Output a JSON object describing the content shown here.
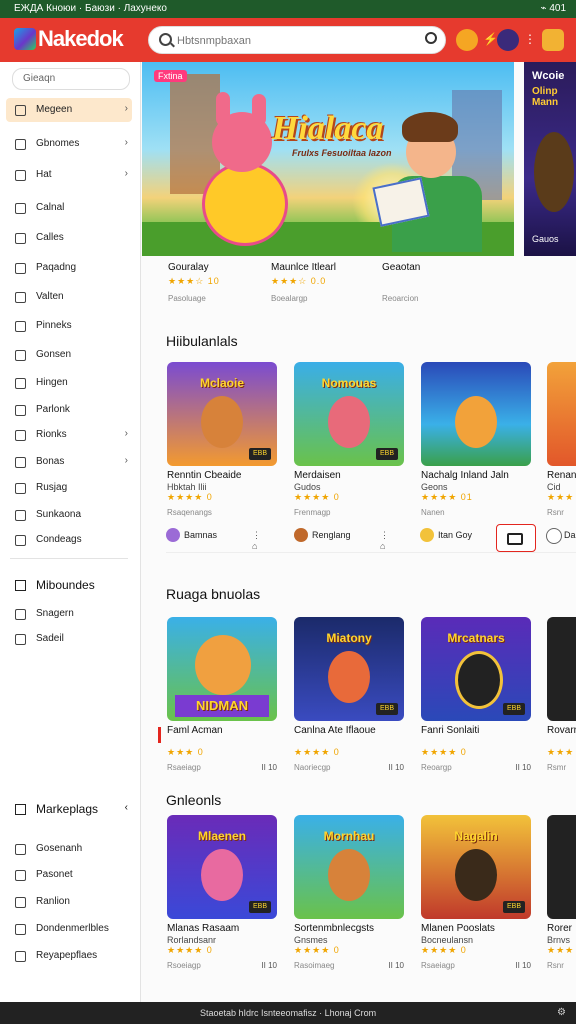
{
  "status": {
    "left": "ЕЖДА  Кноюи · Баюзи  ·  Лахунеко",
    "right": "⌁ 401"
  },
  "app": {
    "brand": "Nakedok",
    "search_placeholder": "Hbtsnmpbaxan"
  },
  "sidebar": {
    "search": "Gieaqn",
    "items": [
      {
        "label": "Megeen",
        "chev": "›",
        "active": true
      },
      {
        "label": "Gbnomes",
        "chev": "›"
      },
      {
        "label": "Hat",
        "chev": "›"
      },
      {
        "label": "Calnal",
        "chev": ""
      },
      {
        "label": "Calles",
        "chev": ""
      },
      {
        "label": "Paqadng",
        "chev": ""
      },
      {
        "label": "Valten",
        "chev": ""
      },
      {
        "label": "Pinneks",
        "chev": ""
      },
      {
        "label": "Gonsen",
        "chev": ""
      },
      {
        "label": "Hingen",
        "chev": ""
      },
      {
        "label": "Parlonk",
        "chev": ""
      },
      {
        "label": "Rionks",
        "chev": "›"
      },
      {
        "label": "Bonas",
        "chev": "›"
      },
      {
        "label": "Rusjag",
        "chev": ""
      },
      {
        "label": "Sunkaona",
        "chev": ""
      },
      {
        "label": "Condeags",
        "chev": ""
      }
    ],
    "section2_head": "Miboundes",
    "section2_items": [
      "Snagern",
      "Sadeil"
    ],
    "section3_head": "Markeplags",
    "section3_items": [
      "Gosenanh",
      "Pasonet",
      "Ranlion",
      "Dondenmerlbles",
      "Reyapepflaes"
    ]
  },
  "hero": {
    "badge": "Fxtina",
    "title": "Hialaca",
    "subtitle": "Frulxs Fesuoiltaa lazon",
    "side_title": "Wcoie",
    "side_sub": "Olinp Mann",
    "side_caption": "Gauos",
    "info": [
      {
        "title": "Gouralay",
        "rating": "★★★☆ 10",
        "meta": "Pasoluage"
      },
      {
        "title": "Maunlce Itlearl",
        "rating": "★★★☆ 0.0",
        "meta": "Boealargp"
      },
      {
        "title": "Geaotan",
        "rating": "",
        "meta": "Reoarcion"
      }
    ]
  },
  "section1": {
    "title": "Hiibulanlals",
    "cards": [
      {
        "banner": "Mclaoie",
        "tag": "EBB",
        "title": "Renntin Cbeaide",
        "sub": "Hbktah Ilii",
        "rating": "★★★★ 0",
        "meta": "Rsaqenangs",
        "x": ""
      },
      {
        "banner": "Nomouas",
        "tag": "EBB",
        "title": "Merdaisen",
        "sub": "Gudos",
        "rating": "★★★★ 0",
        "meta": "Frenmagp",
        "x": ""
      },
      {
        "banner": "",
        "tag": "",
        "title": "Nachalg Inland Jaln",
        "sub": "Geons",
        "rating": "★★★★ 01",
        "meta": "Nanen",
        "x": ""
      },
      {
        "banner": "",
        "tag": "",
        "title": "Renan",
        "sub": "Cid",
        "rating": "★★★",
        "meta": "Rsnr",
        "x": ""
      }
    ],
    "publishers": [
      {
        "label": "Bamnas",
        "action": "⋮ ⌂"
      },
      {
        "label": "Renglang",
        "action": "⋮ ⌂"
      },
      {
        "label": "Itan Goy",
        "action": ""
      },
      {
        "label": "Da",
        "action": ""
      }
    ]
  },
  "section2": {
    "title": "Ruaga bnuolas",
    "cards": [
      {
        "banner": "NIDMAN",
        "tag": "",
        "title": "Faml Acman",
        "sub": "",
        "rating": "★★★ 0",
        "meta": "Rsaeiagp",
        "x": "II 10"
      },
      {
        "banner": "Miatony",
        "tag": "EBB",
        "title": "Canlna Ate Iflaoue",
        "sub": "",
        "rating": "★★★★ 0",
        "meta": "Naoriecgp",
        "x": "II 10"
      },
      {
        "banner": "Mrcatnars",
        "tag": "EBB",
        "title": "Fanri Sonlaiti",
        "sub": "",
        "rating": "★★★★ 0",
        "meta": "Reoargp",
        "x": "II 10"
      },
      {
        "banner": "",
        "tag": "",
        "title": "Rovarr",
        "sub": "",
        "rating": "★★★",
        "meta": "Rsmr",
        "x": ""
      }
    ]
  },
  "section3": {
    "title": "Gnleonls",
    "cards": [
      {
        "banner": "Mlaenen",
        "tag": "EBB",
        "title": "Mlanas Rasaam",
        "sub": "Rorlandsanr",
        "rating": "★★★★ 0",
        "meta": "Rsoeiagp",
        "x": "II 10"
      },
      {
        "banner": "Mornhau",
        "tag": "",
        "title": "Sortenmbnlecgsts",
        "sub": "Gnsmes",
        "rating": "★★★★ 0",
        "meta": "Rasoimaeg",
        "x": "II 10"
      },
      {
        "banner": "Nagalin",
        "tag": "EBB",
        "title": "Mlanen Pooslats",
        "sub": "Bocneulansn",
        "rating": "★★★★ 0",
        "meta": "Rsaeiagp",
        "x": "II 10"
      },
      {
        "banner": "",
        "tag": "",
        "title": "Rorer",
        "sub": "Brnvs",
        "rating": "★★★",
        "meta": "Rsnr",
        "x": ""
      }
    ]
  },
  "footer": {
    "text": "Staoetab hIdrc Isnteeomafisz · Lhonaj Crom"
  }
}
